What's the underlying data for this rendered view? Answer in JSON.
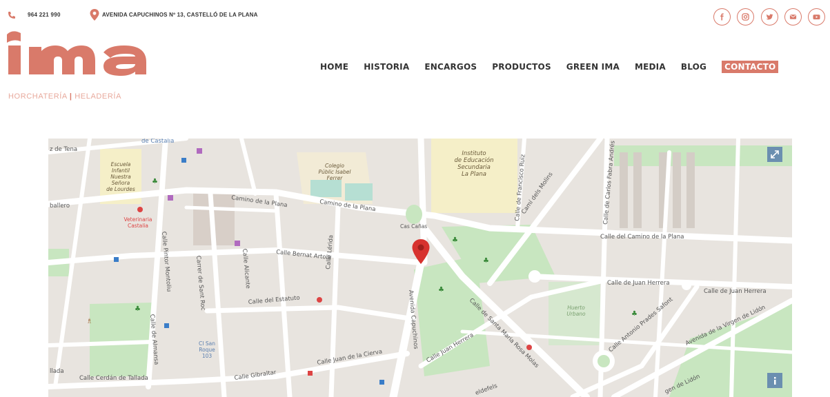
{
  "topbar": {
    "phone": "964 221 990",
    "address": "AVENIDA CAPUCHINOS Nº 13, CASTELLÓ DE LA PLANA",
    "social_icons": [
      "facebook-icon",
      "instagram-icon",
      "twitter-icon",
      "email-icon",
      "youtube-icon"
    ]
  },
  "brand": {
    "logo_text": "ıma",
    "sub_left": "HORCHATERÍA",
    "sub_sep": "|",
    "sub_right": "HELADERÍA",
    "color": "#d97a6a"
  },
  "nav": {
    "items": [
      "HOME",
      "HISTORIA",
      "ENCARGOS",
      "PRODUCTOS",
      "GREEN IMA",
      "MEDIA",
      "BLOG",
      "CONTACTO"
    ],
    "active": "CONTACTO"
  },
  "map": {
    "labels": {
      "de_castalia": "de Castalia",
      "z_de_tena": "z de Tena",
      "escuela": "Escuela\nInfantil\nNuestra\nSeñora\nde Lourdes",
      "colegio": "Colegio\nPúblic Isabel\nFerrer",
      "instituto": "Instituto\nde Educación\nSecundaria\nLa Plana",
      "camino_plana_1": "Camino de la Plana",
      "camino_plana_2": "Camino de la Plana",
      "caballero": "ballero",
      "veterinaria": "Veterinaria\nCastalia",
      "cas_canas": "Cas Cañas",
      "calle_bernat": "Calle Bernat Artola",
      "calle_camino_plana": "Calle del Camino de la Plana",
      "juan_herrera_1": "Calle de Juan Herrera",
      "juan_herrera_2": "Calle de Juan Herrera",
      "calle_estatuto": "Calle del Estatuto",
      "huerto_urbano": "Huerto\nUrbano",
      "cerdan": "Calle Cerdán de Tallada",
      "tallada": "llada",
      "gibraltar": "Calle Gibraltar",
      "juan_cierva": "Calle Juan de la Cierva",
      "juan_herrera_3": "Calle Juan Herrera",
      "santa_maria": "Calle de Santa Maria Rosa Molas",
      "antonio_prades": "Calle Antonio Prades Safont",
      "virgen_lidon": "Avenida de la Virgen de Lidón",
      "lidon": "gen de Lidón",
      "ci_san_roque": "CI San\nRoque\n103",
      "camino_molins": "Camí dels Molins",
      "av_capuchinos": "Avenida Capuchinos",
      "carrer_sant_roc": "Carrer de Sant Roc",
      "calle_almansa": "Calle de Almansa",
      "calle_alicante": "Calle Alicante",
      "calle_lerida": "Calle Lérida",
      "pintor_montoliu": "Calle Pintor Montoliu",
      "francisco_ruiz": "Calle de Francisco Ruiz",
      "carlos_fabra": "Calle de Carlos Fabra Andrés",
      "eldefels": "eldefels"
    }
  }
}
